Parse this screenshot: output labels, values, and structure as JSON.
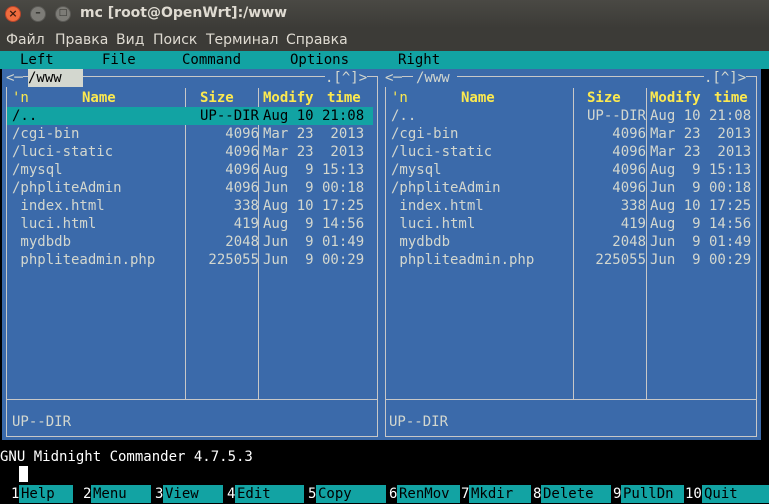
{
  "window": {
    "title": "mc [root@OpenWrt]:/www"
  },
  "gnome_menu": [
    "Файл",
    "Правка",
    "Вид",
    "Поиск",
    "Терминал",
    "Справка"
  ],
  "mc_menu": [
    "Left",
    "File",
    "Command",
    "Options",
    "Right"
  ],
  "columns": {
    "n": "'n",
    "name": "Name",
    "size": "Size",
    "modify": "Modify",
    "time": "time"
  },
  "left_panel": {
    "path": "/www",
    "hotlist": ".[^]>",
    "status": "UP--DIR"
  },
  "right_panel": {
    "path": "/www",
    "hotlist": ".[^]>",
    "status": "UP--DIR"
  },
  "files": [
    {
      "name": "/..",
      "size": "UP--DIR",
      "date": "Aug 10 21:08"
    },
    {
      "name": "/cgi-bin",
      "size": "4096",
      "date": "Mar 23  2013"
    },
    {
      "name": "/luci-static",
      "size": "4096",
      "date": "Mar 23  2013"
    },
    {
      "name": "/mysql",
      "size": "4096",
      "date": "Aug  9 15:13"
    },
    {
      "name": "/phpliteAdmin",
      "size": "4096",
      "date": "Jun  9 00:18"
    },
    {
      "name": " index.html",
      "size": "338",
      "date": "Aug 10 17:25"
    },
    {
      "name": " luci.html",
      "size": "419",
      "date": "Aug  9 14:56"
    },
    {
      "name": " mydbdb",
      "size": "2048",
      "date": "Jun  9 01:49"
    },
    {
      "name": " phpliteadmin.php",
      "size": "225055",
      "date": "Jun  9 00:29"
    }
  ],
  "command_line": "GNU Midnight Commander 4.7.5.3",
  "keybar": [
    {
      "num": "1",
      "label": "Help"
    },
    {
      "num": "2",
      "label": "Menu"
    },
    {
      "num": "3",
      "label": "View"
    },
    {
      "num": "4",
      "label": "Edit"
    },
    {
      "num": "5",
      "label": "Copy"
    },
    {
      "num": "6",
      "label": "RenMov"
    },
    {
      "num": "7",
      "label": "Mkdir"
    },
    {
      "num": "8",
      "label": "Delete"
    },
    {
      "num": "9",
      "label": "PullDn"
    },
    {
      "num": "10",
      "label": "Quit"
    }
  ],
  "colors": {
    "panel": "#3b6aaa",
    "accent": "#12a3a3",
    "header": "#fce94f"
  }
}
